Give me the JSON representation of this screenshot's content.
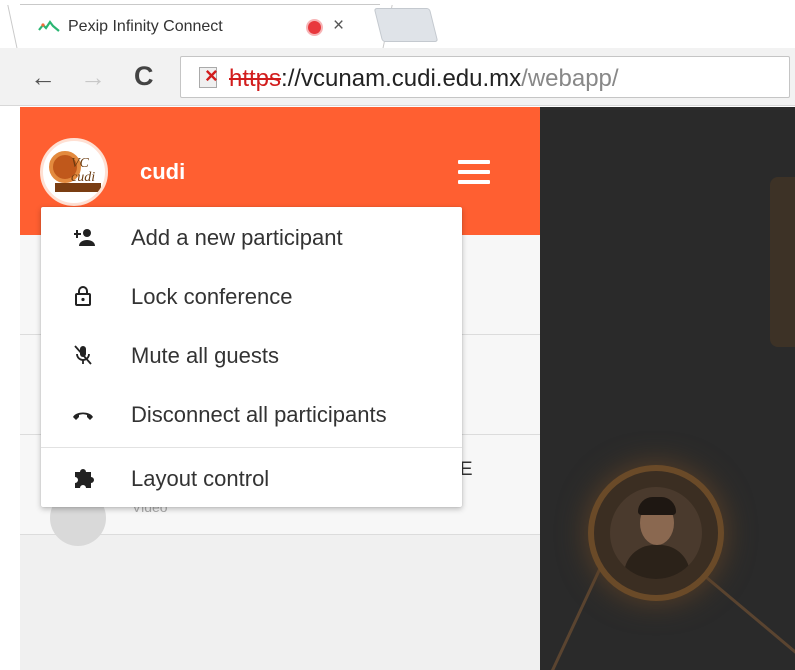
{
  "browser": {
    "tab": {
      "title": "Pexip Infinity Connect",
      "close_glyph": "×",
      "favicon": "pexip-favicon-icon",
      "recording_color": "#e8383d"
    },
    "toolbar": {
      "back_glyph": "←",
      "forward_glyph": "→",
      "reload_glyph": "C",
      "security_glyph": "×",
      "url": {
        "scheme": "https",
        "separator": "://",
        "host": "vcunam.cudi.edu.mx",
        "path": "/webapp/"
      }
    }
  },
  "app": {
    "header": {
      "conference_name": "cudi",
      "accent_color": "#ff5f31",
      "avatar_text": "VC\ncudi"
    },
    "participants": [
      {
        "name_fragment": "ME",
        "subtitle": "Video"
      }
    ],
    "menu": {
      "items": [
        {
          "label": "Add a new participant",
          "icon": "add-person-icon"
        },
        {
          "label": "Lock conference",
          "icon": "lock-icon"
        },
        {
          "label": "Mute all guests",
          "icon": "mic-off-icon"
        },
        {
          "label": "Disconnect all participants",
          "icon": "hang-up-icon"
        },
        {
          "label": "Layout control",
          "icon": "puzzle-icon"
        }
      ]
    }
  }
}
